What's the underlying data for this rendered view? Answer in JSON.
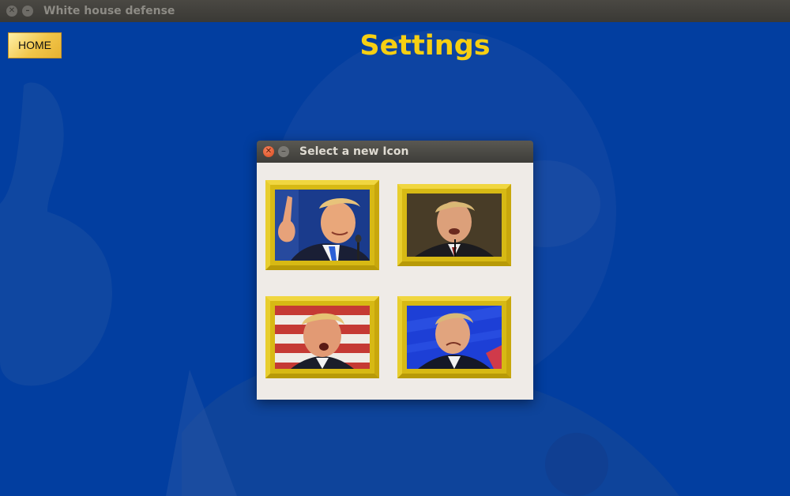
{
  "window": {
    "title": "White house defense"
  },
  "header": {
    "home_label": "HOME",
    "page_title": "Settings"
  },
  "dialog": {
    "title": "Select a new Icon"
  },
  "icon_options": [
    {
      "name": "portrait-pointing-finger",
      "background": "dark-blue"
    },
    {
      "name": "portrait-dark-background",
      "background": "dark-brown"
    },
    {
      "name": "portrait-flag-background",
      "background": "red-white-stripes"
    },
    {
      "name": "portrait-blue-background",
      "background": "bright-blue"
    }
  ],
  "colors": {
    "background_blue": "#023ea0",
    "title_yellow": "#f6cf12",
    "frame_gold": "#d7b914",
    "dialog_bg": "#efebe7"
  }
}
